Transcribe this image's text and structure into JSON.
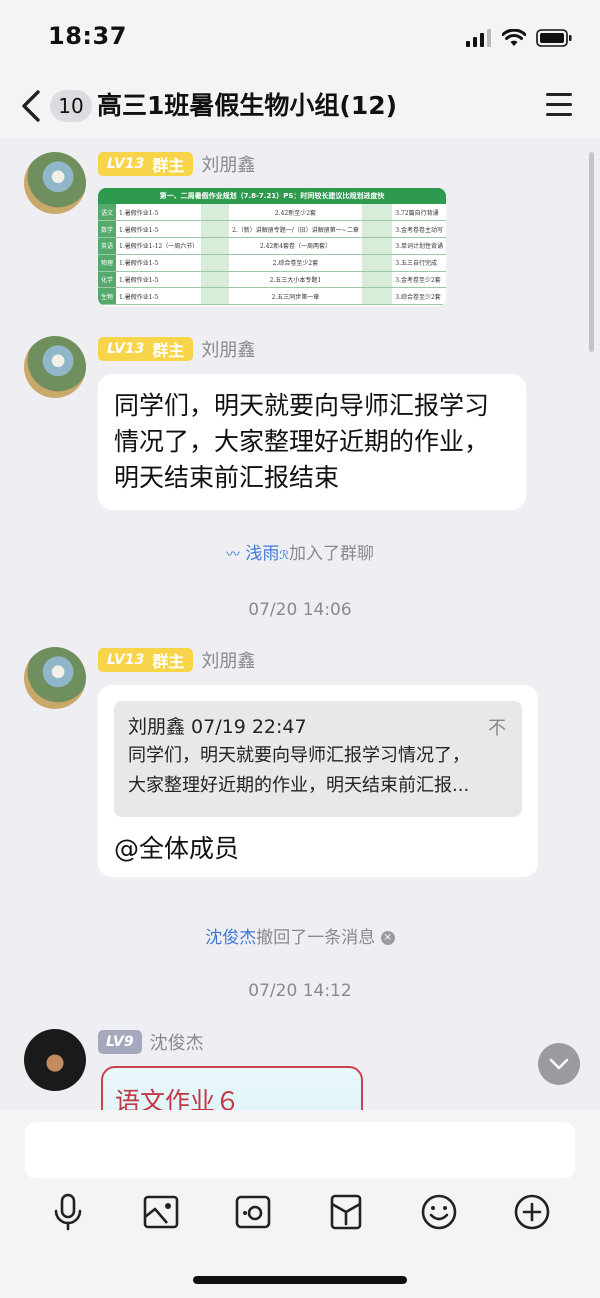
{
  "status_bar": {
    "time": "18:37"
  },
  "nav": {
    "unread_count": "10",
    "title": "高三1班暑假生物小组(12)"
  },
  "messages": [
    {
      "level": "LV13",
      "role": "群主",
      "sender": "刘朋鑫",
      "image": {
        "header": "第一、二周暑假作业规划（7.8-7.21）PS：时间较长建议比规划进度快",
        "rows": [
          [
            "语文",
            "1.暑假作业1-5",
            "2.42新至少2套",
            "3.72篇自行背诵"
          ],
          [
            "数学",
            "1.暑假作业1-5",
            "2.（新）讲解册专题一/（旧）讲解册第一~二章",
            "3.金考卷卷主动写"
          ],
          [
            "英语",
            "1.暑假作业1-12（一周六节）",
            "2.42新4套卷（一周两套）",
            "3.单词计划性背诵"
          ],
          [
            "物理",
            "1.暑假作业1-5",
            "2.综合卷至少2套",
            "3.五三自行完成"
          ],
          [
            "化学",
            "1.暑假作业1-5",
            "2.五三大小本专题1",
            "3.金考卷至少2套"
          ],
          [
            "生物",
            "1.暑假作业1-5",
            "2.五三同步第一章",
            "3.综合卷至少2套"
          ]
        ]
      }
    },
    {
      "level": "LV13",
      "role": "群主",
      "sender": "刘朋鑫",
      "text": "同学们，明天就要向导师汇报学习情况了，大家整理好近期的作业，明天结束前汇报结束"
    },
    {
      "system": true,
      "join_name": "浅雨",
      "join_suffix": "ℛ",
      "join_text": "加入了群聊"
    },
    {
      "timestamp": "07/20 14:06"
    },
    {
      "level": "LV13",
      "role": "群主",
      "sender": "刘朋鑫",
      "quote": {
        "head": "刘朋鑫 07/19 22:47",
        "pin": "不",
        "line1": "同学们，明天就要向导师汇报学习情况了，",
        "line2": "大家整理好近期的作业，明天结束前汇报..."
      },
      "text": "@全体成员"
    },
    {
      "system": true,
      "recall_name": "沈俊杰",
      "recall_text": "撤回了一条消息"
    },
    {
      "timestamp": "07/20 14:12"
    },
    {
      "level": "LV9",
      "sender": "沈俊杰",
      "note_text": "语文作业６"
    }
  ],
  "input": {
    "placeholder": ""
  },
  "toolbar": [
    "mic-icon",
    "image-icon",
    "camera-icon",
    "red-packet-icon",
    "emoji-icon",
    "plus-icon"
  ]
}
